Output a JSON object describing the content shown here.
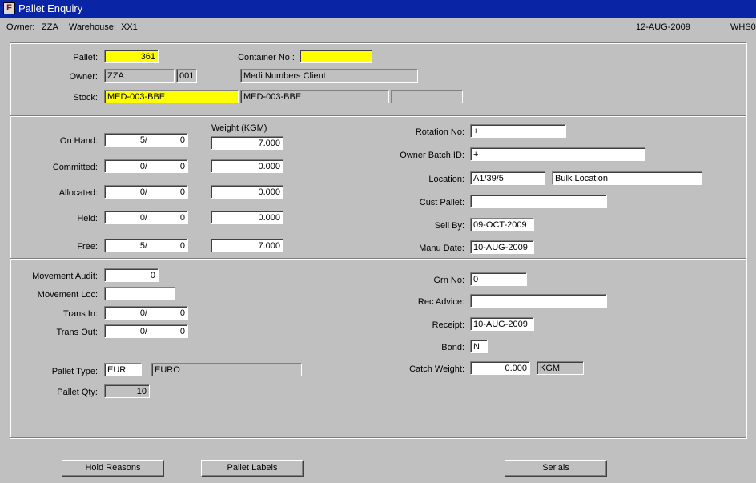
{
  "window": {
    "title": "Pallet Enquiry"
  },
  "info": {
    "owner_label": "Owner:",
    "owner": "ZZA",
    "warehouse_label": "Warehouse:",
    "warehouse": "XX1",
    "date": "12-AUG-2009",
    "code": "WHS0"
  },
  "header": {
    "pallet_label": "Pallet:",
    "pallet_value": "361",
    "container_label": "Container No :",
    "container_value": "",
    "owner_label": "Owner:",
    "owner_code": "ZZA",
    "owner_num": "001",
    "owner_name": "Medi Numbers Client",
    "stock_label": "Stock:",
    "stock_code": "MED-003-BBE",
    "stock_desc": "MED-003-BBE",
    "stock_extra": ""
  },
  "quantities": {
    "weight_header": "Weight (KGM)",
    "rows": [
      {
        "label": "On Hand:",
        "qty": "5/",
        "sub": "0",
        "weight": "7.000"
      },
      {
        "label": "Committed:",
        "qty": "0/",
        "sub": "0",
        "weight": "0.000"
      },
      {
        "label": "Allocated:",
        "qty": "0/",
        "sub": "0",
        "weight": "0.000"
      },
      {
        "label": "Held:",
        "qty": "0/",
        "sub": "0",
        "weight": "0.000"
      },
      {
        "label": "Free:",
        "qty": "5/",
        "sub": "0",
        "weight": "7.000"
      }
    ]
  },
  "details": {
    "rotation_label": "Rotation No:",
    "rotation": "+",
    "batch_label": "Owner Batch ID:",
    "batch": "+",
    "location_label": "Location:",
    "location": "A1/39/5",
    "location_desc": "Bulk Location",
    "cust_pallet_label": "Cust Pallet:",
    "cust_pallet": "",
    "sell_by_label": "Sell By:",
    "sell_by": "09-OCT-2009",
    "manu_date_label": "Manu Date:",
    "manu_date": "10-AUG-2009"
  },
  "movement": {
    "audit_label": "Movement Audit:",
    "audit": "0",
    "loc_label": "Movement Loc:",
    "loc": "",
    "trans_in_label": "Trans In:",
    "trans_in_qty": "0/",
    "trans_in_sub": "0",
    "trans_out_label": "Trans Out:",
    "trans_out_qty": "0/",
    "trans_out_sub": "0",
    "pallet_type_label": "Pallet Type:",
    "pallet_type": "EUR",
    "pallet_type_desc": "EURO",
    "pallet_qty_label": "Pallet Qty:",
    "pallet_qty": "10"
  },
  "receipt": {
    "grn_label": "Grn No:",
    "grn": "0",
    "rec_advice_label": "Rec Advice:",
    "rec_advice": "",
    "receipt_label": "Receipt:",
    "receipt": "10-AUG-2009",
    "bond_label": "Bond:",
    "bond": "N",
    "catch_label": "Catch Weight:",
    "catch": "0.000",
    "catch_unit": "KGM"
  },
  "buttons": {
    "hold_reasons": "Hold Reasons",
    "pallet_labels": "Pallet Labels",
    "serials": "Serials"
  }
}
